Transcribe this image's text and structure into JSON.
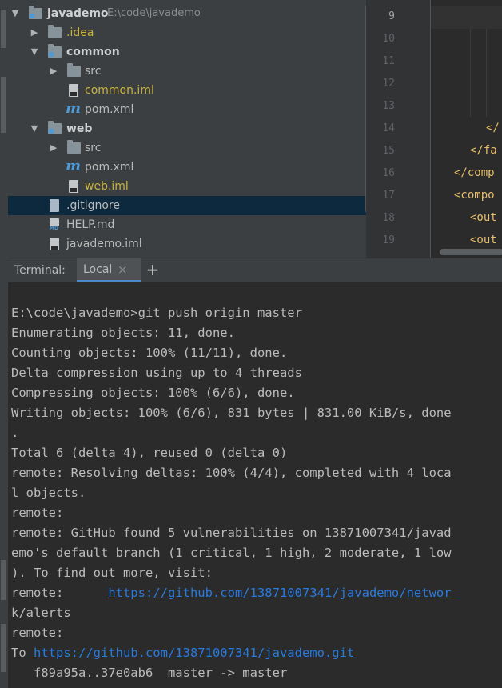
{
  "project": {
    "root_name": "javademo",
    "root_path": "E:\\code\\javademo",
    "items": {
      "idea": ".idea",
      "common": "common",
      "common_src": "src",
      "common_iml": "common.iml",
      "common_pom": "pom.xml",
      "web": "web",
      "web_src": "src",
      "web_pom": "pom.xml",
      "web_iml": "web.iml",
      "gitignore": ".gitignore",
      "help": "HELP.md",
      "javademo_iml": "javademo.iml"
    }
  },
  "editor": {
    "line_numbers": [
      "9",
      "10",
      "11",
      "12",
      "13",
      "14",
      "15",
      "16",
      "17",
      "18",
      "19"
    ],
    "code_fragments": [
      "</",
      "</fa",
      "</comp",
      "<compo",
      "<out",
      "<out"
    ]
  },
  "terminal": {
    "title": "Terminal:",
    "tab_label": "Local",
    "close_glyph": "×",
    "add_glyph": "+",
    "lines": [
      "E:\\code\\javademo>git push origin master",
      "Enumerating objects: 11, done.",
      "Counting objects: 100% (11/11), done.",
      "Delta compression using up to 4 threads",
      "Compressing objects: 100% (6/6), done.",
      "Writing objects: 100% (6/6), 831 bytes | 831.00 KiB/s, done",
      ".",
      "Total 6 (delta 4), reused 0 (delta 0)",
      "remote: Resolving deltas: 100% (4/4), completed with 4 loca",
      "l objects.",
      "remote:",
      "remote: GitHub found 5 vulnerabilities on 13871007341/javad",
      "emo's default branch (1 critical, 1 high, 2 moderate, 1 low",
      "). To find out more, visit:"
    ],
    "remote_prefix": "remote:      ",
    "alerts_link": "https://github.com/13871007341/javademo/networ",
    "alerts_link_cont": "k/alerts",
    "remote_blank": "remote:",
    "to_prefix": "To ",
    "repo_link": "https://github.com/13871007341/javademo.git",
    "push_result": "   f89a95a..37e0ab6  master -> master"
  },
  "colors": {
    "link": "#287bde",
    "selection": "#0d293e",
    "ignored_file": "#c7b242",
    "xml_tag": "#e8bf6a"
  }
}
